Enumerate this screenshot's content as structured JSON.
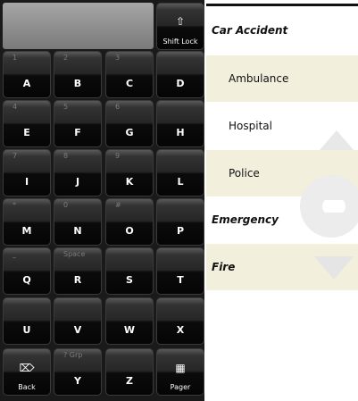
{
  "keypad": {
    "shift_key": {
      "icon": "shift-arrow-icon",
      "label": "Shift Lock"
    },
    "keys": [
      {
        "sec": "1",
        "main": "A"
      },
      {
        "sec": "2",
        "main": "B"
      },
      {
        "sec": "3",
        "main": "C"
      },
      {
        "sec": "",
        "main": "D"
      },
      {
        "sec": "4",
        "main": "E"
      },
      {
        "sec": "5",
        "main": "F"
      },
      {
        "sec": "6",
        "main": "G"
      },
      {
        "sec": "",
        "main": "H"
      },
      {
        "sec": "7",
        "main": "I"
      },
      {
        "sec": "8",
        "main": "J"
      },
      {
        "sec": "9",
        "main": "K"
      },
      {
        "sec": "",
        "main": "L"
      },
      {
        "sec": "*",
        "main": "M"
      },
      {
        "sec": "0",
        "main": "N"
      },
      {
        "sec": "#",
        "main": "O"
      },
      {
        "sec": "",
        "main": "P"
      },
      {
        "sec": "_",
        "main": "Q"
      },
      {
        "sec": "Space",
        "main": "R"
      },
      {
        "sec": "",
        "main": "S"
      },
      {
        "sec": "",
        "main": "T"
      },
      {
        "sec": "",
        "main": "U"
      },
      {
        "sec": "",
        "main": "V"
      },
      {
        "sec": "",
        "main": "W"
      },
      {
        "sec": "",
        "main": "X"
      },
      {
        "sec": "",
        "main": "Y"
      },
      {
        "sec": "",
        "main": "Z"
      }
    ],
    "back_key": {
      "icon": "backspace-icon",
      "label": "Back"
    },
    "grp_key": {
      "sec": "? Grp",
      "main": "Y"
    },
    "pager_key": {
      "icon": "grid-icon",
      "label": "Pager"
    }
  },
  "list": {
    "rows": [
      {
        "type": "header",
        "label": "Car Accident"
      },
      {
        "type": "item",
        "label": "Ambulance"
      },
      {
        "type": "item",
        "label": "Hospital"
      },
      {
        "type": "item",
        "label": "Police"
      },
      {
        "type": "header",
        "label": "Emergency"
      },
      {
        "type": "header",
        "label": "Fire"
      }
    ]
  }
}
